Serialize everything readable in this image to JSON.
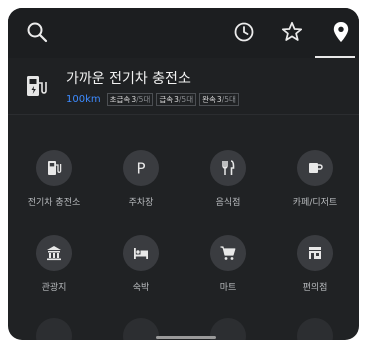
{
  "header": {
    "icons": [
      "search-icon",
      "history-icon",
      "star-icon",
      "location-icon"
    ],
    "active_tab": "location"
  },
  "nearest_station": {
    "title": "가까운 전기차 충전소",
    "distance": "100km",
    "chargers": [
      {
        "type": "초급속",
        "available": "3",
        "total": "/5대"
      },
      {
        "type": "급속",
        "available": "3",
        "total": "/5대"
      },
      {
        "type": "완속",
        "available": "3",
        "total": "/5대"
      }
    ]
  },
  "categories": [
    {
      "label": "전기차 충전소",
      "icon": "ev-charger-icon"
    },
    {
      "label": "주차장",
      "icon": "parking-icon"
    },
    {
      "label": "음식점",
      "icon": "restaurant-icon"
    },
    {
      "label": "카페/디저트",
      "icon": "cafe-icon"
    },
    {
      "label": "관광지",
      "icon": "landmark-icon"
    },
    {
      "label": "숙박",
      "icon": "bed-icon"
    },
    {
      "label": "마트",
      "icon": "cart-icon"
    },
    {
      "label": "편의점",
      "icon": "store-icon"
    }
  ],
  "colors": {
    "background": "#202224",
    "accent_distance": "#3d8bff",
    "icon_circle": "#3a3c40"
  }
}
